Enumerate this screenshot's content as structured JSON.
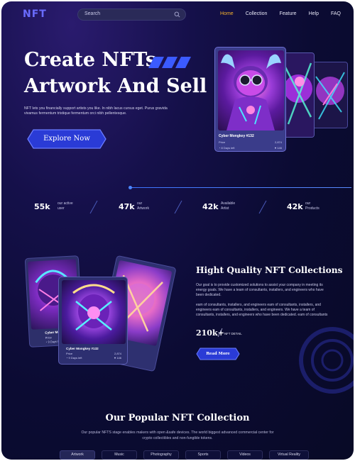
{
  "nav": {
    "logo": "NFT",
    "search_placeholder": "Search",
    "links": [
      "Home",
      "Collection",
      "Feature",
      "Help",
      "FAQ"
    ],
    "active_link": "Home",
    "active_color": "#f5b12d"
  },
  "hero": {
    "title_line1": "Create NFTs",
    "title_line2": "Artwork And Sell",
    "description": "NFT lets you financially support artists you like. In nibh lacus cursus eget. Purus gravida vivamus fermentum tristique fermentum orci nibh pellentesque.",
    "cta": "Explore Now"
  },
  "featured_card": {
    "title": "Cyber Mongkey #132",
    "price_label": "Price",
    "price_value": "2,874",
    "time_label": "8 Days left",
    "likes": "146"
  },
  "stats": [
    {
      "value": "55k",
      "label_line1": "our active",
      "label_line2": "user"
    },
    {
      "value": "47k",
      "label_line1": "our",
      "label_line2": "Artwork"
    },
    {
      "value": "42k",
      "label_line1": "Available",
      "label_line2": "Artist"
    },
    {
      "value": "42k",
      "label_line1": "our",
      "label_line2": "Products"
    }
  ],
  "collection_cards": {
    "left": {
      "title": "Cyber Mongkey #132",
      "price_label": "Price",
      "time_label": "9 Days left"
    },
    "front": {
      "title": "Cyber Mongkey #132",
      "price_label": "Price",
      "price_value": "2,874",
      "time_label": "9 Days left",
      "likes": "146"
    }
  },
  "quality": {
    "title": "Hight Quality NFT Collections",
    "para1": "Our goal is to provide customized solutions to assist your company in meeting its energy goals. We have a team of consultants, installers, and engineers who have been dedicated.",
    "para2": "eam of consultants, installers, and engineers eam of consultants, installers, and engineers eam of consultants, installers, and engineers. We have a team of consultants, installers, and engineers who have been dedicated. eam of consultants",
    "stat_value": "210k+",
    "stat_label": "NFT DETAIL",
    "cta": "Read More"
  },
  "popular": {
    "title": "Our Popular NFT Collection",
    "description": "Our popular NFTS stage enables makers with open &safe devices. The world biggest advanced commercial center for crypto collectibles and non-fungible tokens.",
    "tabs": [
      "Artwork",
      "Music",
      "Photography",
      "Sports",
      "Videos",
      "Virtual Reality"
    ],
    "active_tab": "Artwork"
  },
  "colors": {
    "accent_blue": "#3b5bff",
    "background": "#0b0b33"
  }
}
